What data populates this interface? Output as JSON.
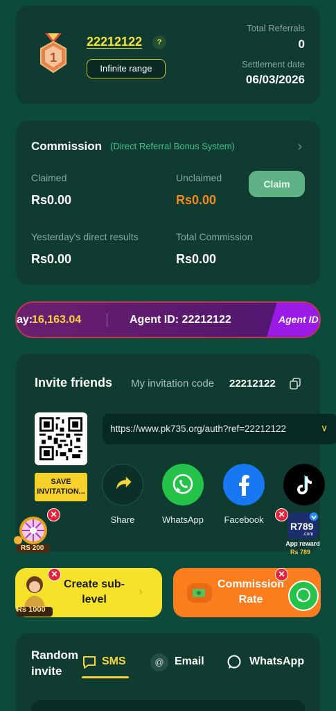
{
  "agent": {
    "code": "22212122",
    "help": "?",
    "range_label": "Infinite range",
    "medal_rank": "1",
    "total_referrals_label": "Total Referrals",
    "total_referrals": "0",
    "settlement_label": "Settlement date",
    "settlement_date": "06/03/2026"
  },
  "commission": {
    "title": "Commission",
    "subtitle": "(Direct Referral Bonus System)",
    "claimed_label": "Claimed",
    "claimed_value": "Rs0.00",
    "unclaimed_label": "Unclaimed",
    "unclaimed_value": "Rs0.00",
    "claim_button": "Claim",
    "yesterday_label": "Yesterday's direct results",
    "yesterday_value": "Rs0.00",
    "total_label": "Total Commission",
    "total_value": "Rs0.00"
  },
  "marquee": {
    "today_label": "ay:",
    "today_value": "16,163.04",
    "agent_label": "Agent ID: 22212122",
    "tag_label": "Agent ID:"
  },
  "invite": {
    "title": "Invite friends",
    "code_label": "My invitation code",
    "code": "22212122",
    "link": "https://www.pk735.org/auth?ref=22212122",
    "save_button": "SAVE INVITATION...",
    "share_items": [
      {
        "label": "Share"
      },
      {
        "label": "WhatsApp"
      },
      {
        "label": "Facebook"
      },
      {
        "label": ""
      }
    ]
  },
  "promos": {
    "wheel_amount": "RS 200",
    "r789_brand": "R789",
    "r789_sub": ".com",
    "r789_reward": "App reward",
    "r789_amount": "Rs 789",
    "girl_amount": "Rs 1000"
  },
  "tiles": {
    "sub_level": "Create sub-level",
    "commission_rate": "Commission Rate"
  },
  "random_invite": {
    "title": "Random invite",
    "tabs": [
      "SMS",
      "Email",
      "WhatsApp"
    ]
  },
  "colors": {
    "background": "#0c4a3c",
    "card": "#0f3b31",
    "accent_yellow": "#f6e23a",
    "accent_green": "#44c28d",
    "unclaimed_orange": "#f08a1e",
    "claim_button": "#5fb285"
  }
}
